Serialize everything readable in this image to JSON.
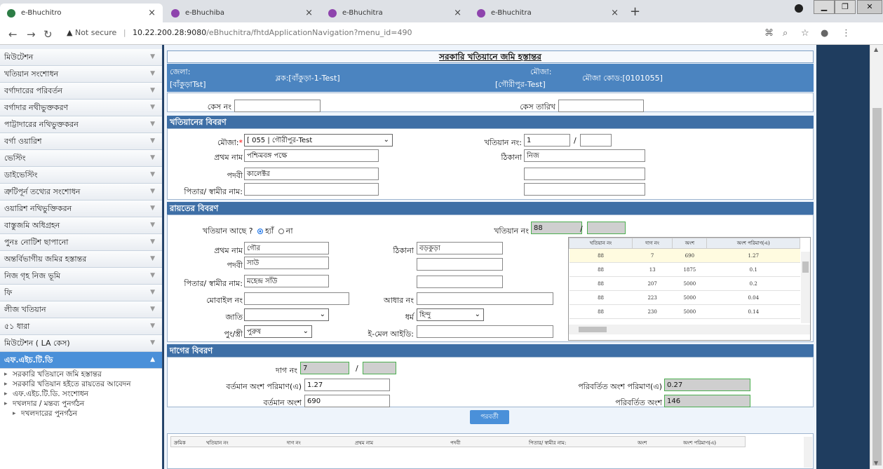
{
  "browser": {
    "tabs": [
      {
        "label": "e-Bhuchitro",
        "active": true
      },
      {
        "label": "e-Bhuchiba",
        "active": false
      },
      {
        "label": "e-Bhuchitra",
        "active": false
      },
      {
        "label": "e-Bhuchitra",
        "active": false
      }
    ],
    "not_secure": "Not secure",
    "url_host": "10.22.200.28:9080",
    "url_path": "/eBhuchitra/fhtdApplicationNavigation?menu_id=490"
  },
  "sidebar": {
    "items": [
      "মিউটেশন",
      "খতিয়ান সংশোধন",
      "বর্গাদারের পরিবর্তন",
      "বর্গাদার নথীভুক্তকরণ",
      "পাট্টাদারের নথিভুক্তকরন",
      "বর্গা ওয়ারিশ",
      "ভেস্টিং",
      "ডাইভেস্টিং",
      "ত্রুটিপূর্ন তথ্যের সংশোধন",
      "ওয়ারিশ নথিভুক্তিকরন",
      "বাস্তুজমি অধিগ্রহন",
      "পুনঃ নোটিশ ছাপানো",
      "অন্তর্বিভাগীয় জমির হস্তান্তর",
      "নিজ গৃহ নিজ ভূমি",
      "ফি",
      "লীজ খতিয়ান",
      "৫১ ধারা",
      "মিউটেশন ( LA কেস)"
    ],
    "active": "এফ.এইচ.টি.ডি",
    "sub_items": [
      "সরকারি খতিয়ানে জমি হস্তান্তর",
      "সরকারি খতিয়ান হইতে রায়তের আবেদন",
      "এফ.এইচ.টি.ডি. সংশোধন",
      "দখলদার / মন্তব্য পুনর্গঠন"
    ],
    "sub_sub_items": [
      "দখলদারের পুনর্গঠন"
    ]
  },
  "form": {
    "title": "সরকারি খতিয়ানে জমি হস্তান্তর",
    "district_label": "জেলা:",
    "district_value": "[বাঁকুড়াTst]",
    "block": "ব্লক:[বাঁকুড়া-1-Test]",
    "mouza_label": "মৌজা:",
    "mouza_value": "[গৌরীপুর-Test]",
    "mouza_code": "মৌজা কোড:[0101055]",
    "case_no_label": "কেস নং",
    "case_date_label": "কেস তারিখ",
    "khatian_section": "খতিয়ানের বিবরণ",
    "mouza_sel_label": "মৌজা:",
    "mouza_sel_value": "[ 055 | গৌরীপুর-Test",
    "khatian_no_label": "খতিয়ান নং:",
    "khatian_no_value": "1",
    "first_name_label": "প্রথম নাম",
    "first_name_value": "পশ্চিমবঙ্গ পক্ষে",
    "address_label": "ঠিকানা",
    "address_value": "নিজ",
    "designation_label": "পদবী",
    "designation_value": "কালেক্টর",
    "father_label": "পিতার/ স্বামীর নাম:",
    "raiyat_section": "রায়তের বিবরণ",
    "khatian_exists_label": "খতিয়ান আছে ?",
    "yes": "হ্যাঁ",
    "no": "না",
    "r_khatian_label": "খতিয়ান নং",
    "r_khatian_value": "88",
    "r_first_name_value": "গৌর",
    "r_address_value": "বড়কুড়া",
    "r_designation_value": "সাউ",
    "r_father_value": "মহেন্দ্র সাঁউ",
    "mobile_label": "মোবাইল নং",
    "aadhar_label": "আধার নং",
    "caste_label": "জাতি",
    "religion_label": "ধর্ম",
    "religion_value": "হিন্দু",
    "gender_label": "পুং/স্ত্রী",
    "gender_value": "পুরুষ",
    "email_label": "ই-মেল আইডি:",
    "dag_section": "দাগের বিবরণ",
    "dag_no_label": "দাগ নং",
    "dag_no_value": "7",
    "cur_share_area_label": "বর্তমান অংশ পরিমাণ(এ)",
    "cur_share_area_value": "1.27",
    "chg_share_area_label": "পরিবর্তিত অংশ পরিমাণ(এ)",
    "chg_share_area_value": "0.27",
    "cur_share_label": "বর্তমান অংশ",
    "cur_share_value": "690",
    "chg_share_label": "পরিবর্তিত অংশ",
    "chg_share_value": "146",
    "next_button": "পরবর্তী"
  },
  "grid": {
    "headers": [
      "খতিয়ান নং",
      "দাগ নং",
      "অংশ",
      "অংশ পরিমাণ(এ)"
    ],
    "rows": [
      [
        "88",
        "7",
        "690",
        "1.27"
      ],
      [
        "88",
        "13",
        "1875",
        "0.1"
      ],
      [
        "88",
        "207",
        "5000",
        "0.2"
      ],
      [
        "88",
        "223",
        "5000",
        "0.04"
      ],
      [
        "88",
        "230",
        "5000",
        "0.14"
      ]
    ]
  },
  "bottom_table": {
    "headers": [
      "ক্রমিক",
      "খতিয়ান নং",
      "দাগ নং",
      "প্রথম নাম",
      "পদবী",
      "পিতার/ স্বামীর নাম:",
      "অংশ",
      "অংশ পরিমাণ(এ)"
    ]
  }
}
